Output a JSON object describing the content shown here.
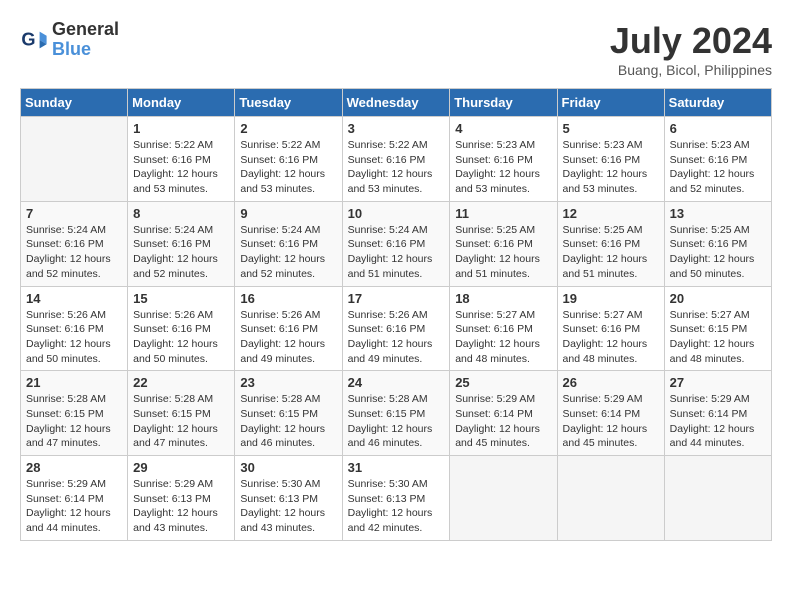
{
  "header": {
    "logo_line1": "General",
    "logo_line2": "Blue",
    "month_year": "July 2024",
    "location": "Buang, Bicol, Philippines"
  },
  "calendar": {
    "days_of_week": [
      "Sunday",
      "Monday",
      "Tuesday",
      "Wednesday",
      "Thursday",
      "Friday",
      "Saturday"
    ],
    "weeks": [
      [
        {
          "day": "",
          "info": ""
        },
        {
          "day": "1",
          "info": "Sunrise: 5:22 AM\nSunset: 6:16 PM\nDaylight: 12 hours\nand 53 minutes."
        },
        {
          "day": "2",
          "info": "Sunrise: 5:22 AM\nSunset: 6:16 PM\nDaylight: 12 hours\nand 53 minutes."
        },
        {
          "day": "3",
          "info": "Sunrise: 5:22 AM\nSunset: 6:16 PM\nDaylight: 12 hours\nand 53 minutes."
        },
        {
          "day": "4",
          "info": "Sunrise: 5:23 AM\nSunset: 6:16 PM\nDaylight: 12 hours\nand 53 minutes."
        },
        {
          "day": "5",
          "info": "Sunrise: 5:23 AM\nSunset: 6:16 PM\nDaylight: 12 hours\nand 53 minutes."
        },
        {
          "day": "6",
          "info": "Sunrise: 5:23 AM\nSunset: 6:16 PM\nDaylight: 12 hours\nand 52 minutes."
        }
      ],
      [
        {
          "day": "7",
          "info": "Sunrise: 5:24 AM\nSunset: 6:16 PM\nDaylight: 12 hours\nand 52 minutes."
        },
        {
          "day": "8",
          "info": "Sunrise: 5:24 AM\nSunset: 6:16 PM\nDaylight: 12 hours\nand 52 minutes."
        },
        {
          "day": "9",
          "info": "Sunrise: 5:24 AM\nSunset: 6:16 PM\nDaylight: 12 hours\nand 52 minutes."
        },
        {
          "day": "10",
          "info": "Sunrise: 5:24 AM\nSunset: 6:16 PM\nDaylight: 12 hours\nand 51 minutes."
        },
        {
          "day": "11",
          "info": "Sunrise: 5:25 AM\nSunset: 6:16 PM\nDaylight: 12 hours\nand 51 minutes."
        },
        {
          "day": "12",
          "info": "Sunrise: 5:25 AM\nSunset: 6:16 PM\nDaylight: 12 hours\nand 51 minutes."
        },
        {
          "day": "13",
          "info": "Sunrise: 5:25 AM\nSunset: 6:16 PM\nDaylight: 12 hours\nand 50 minutes."
        }
      ],
      [
        {
          "day": "14",
          "info": "Sunrise: 5:26 AM\nSunset: 6:16 PM\nDaylight: 12 hours\nand 50 minutes."
        },
        {
          "day": "15",
          "info": "Sunrise: 5:26 AM\nSunset: 6:16 PM\nDaylight: 12 hours\nand 50 minutes."
        },
        {
          "day": "16",
          "info": "Sunrise: 5:26 AM\nSunset: 6:16 PM\nDaylight: 12 hours\nand 49 minutes."
        },
        {
          "day": "17",
          "info": "Sunrise: 5:26 AM\nSunset: 6:16 PM\nDaylight: 12 hours\nand 49 minutes."
        },
        {
          "day": "18",
          "info": "Sunrise: 5:27 AM\nSunset: 6:16 PM\nDaylight: 12 hours\nand 48 minutes."
        },
        {
          "day": "19",
          "info": "Sunrise: 5:27 AM\nSunset: 6:16 PM\nDaylight: 12 hours\nand 48 minutes."
        },
        {
          "day": "20",
          "info": "Sunrise: 5:27 AM\nSunset: 6:15 PM\nDaylight: 12 hours\nand 48 minutes."
        }
      ],
      [
        {
          "day": "21",
          "info": "Sunrise: 5:28 AM\nSunset: 6:15 PM\nDaylight: 12 hours\nand 47 minutes."
        },
        {
          "day": "22",
          "info": "Sunrise: 5:28 AM\nSunset: 6:15 PM\nDaylight: 12 hours\nand 47 minutes."
        },
        {
          "day": "23",
          "info": "Sunrise: 5:28 AM\nSunset: 6:15 PM\nDaylight: 12 hours\nand 46 minutes."
        },
        {
          "day": "24",
          "info": "Sunrise: 5:28 AM\nSunset: 6:15 PM\nDaylight: 12 hours\nand 46 minutes."
        },
        {
          "day": "25",
          "info": "Sunrise: 5:29 AM\nSunset: 6:14 PM\nDaylight: 12 hours\nand 45 minutes."
        },
        {
          "day": "26",
          "info": "Sunrise: 5:29 AM\nSunset: 6:14 PM\nDaylight: 12 hours\nand 45 minutes."
        },
        {
          "day": "27",
          "info": "Sunrise: 5:29 AM\nSunset: 6:14 PM\nDaylight: 12 hours\nand 44 minutes."
        }
      ],
      [
        {
          "day": "28",
          "info": "Sunrise: 5:29 AM\nSunset: 6:14 PM\nDaylight: 12 hours\nand 44 minutes."
        },
        {
          "day": "29",
          "info": "Sunrise: 5:29 AM\nSunset: 6:13 PM\nDaylight: 12 hours\nand 43 minutes."
        },
        {
          "day": "30",
          "info": "Sunrise: 5:30 AM\nSunset: 6:13 PM\nDaylight: 12 hours\nand 43 minutes."
        },
        {
          "day": "31",
          "info": "Sunrise: 5:30 AM\nSunset: 6:13 PM\nDaylight: 12 hours\nand 42 minutes."
        },
        {
          "day": "",
          "info": ""
        },
        {
          "day": "",
          "info": ""
        },
        {
          "day": "",
          "info": ""
        }
      ]
    ]
  }
}
